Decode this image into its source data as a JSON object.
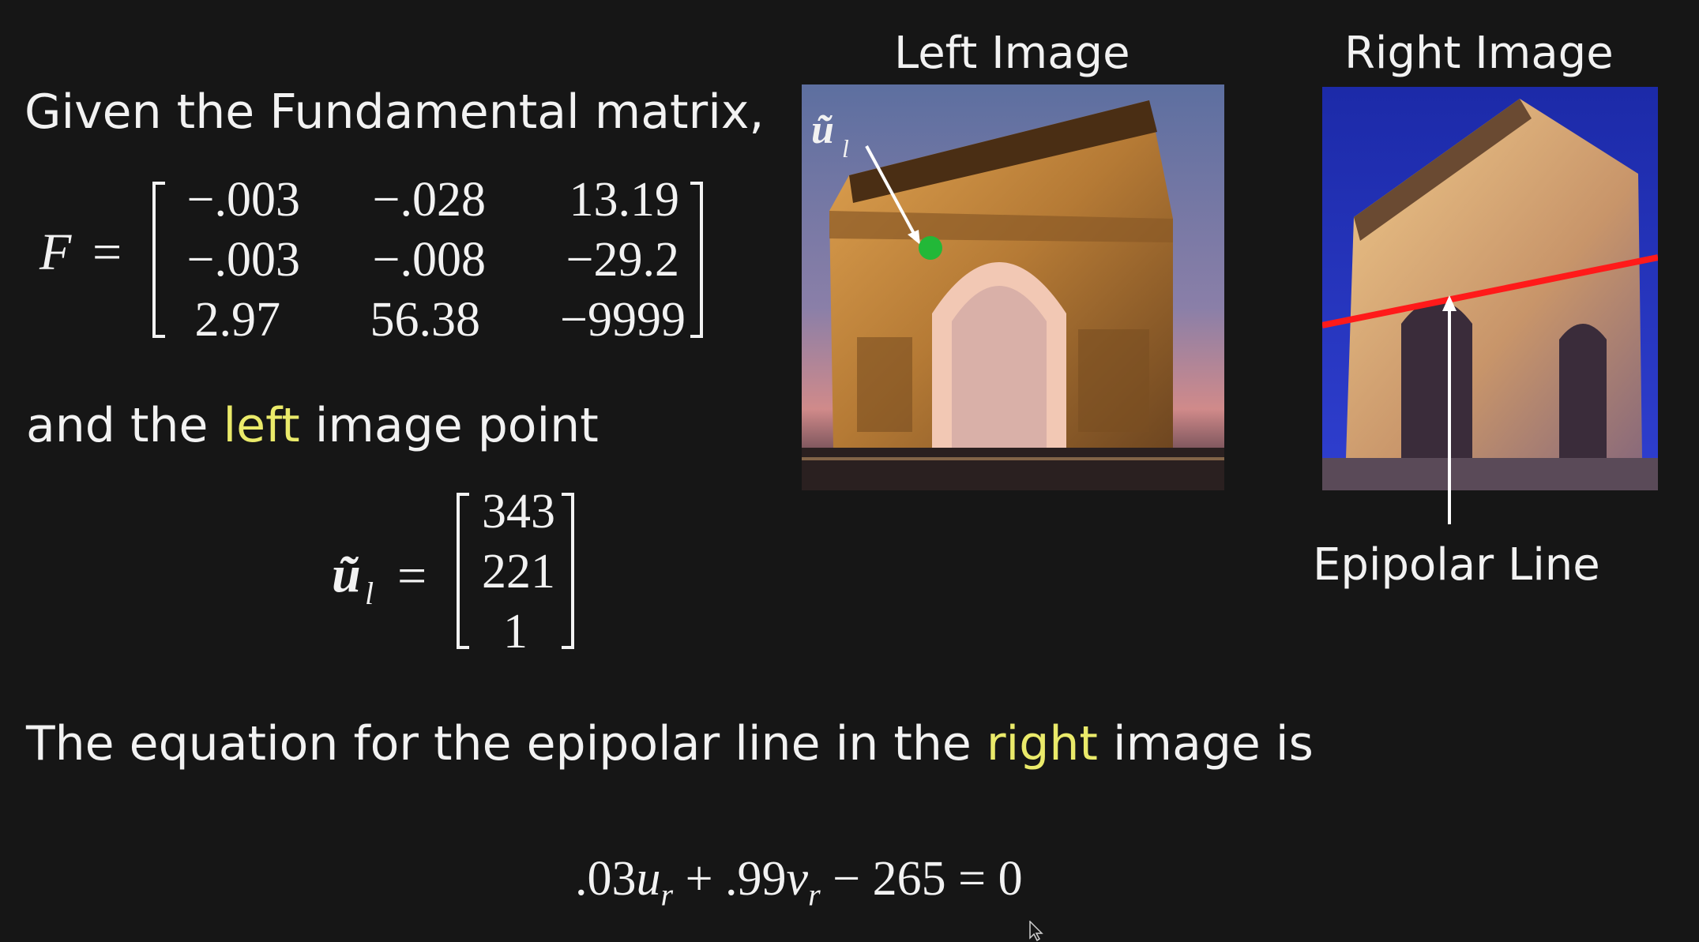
{
  "slide": {
    "intro_text": "Given the Fundamental matrix,",
    "point_text_pre": "and the ",
    "point_text_highlight": "left",
    "point_text_post": " image point",
    "result_text_pre": "The equation for the epipolar line in the ",
    "result_text_highlight": "right",
    "result_text_post": " image is",
    "highlight_color": "#eaea6a"
  },
  "fundamental_matrix": {
    "symbol": "F",
    "equals": "=",
    "rows": [
      [
        "−.003",
        "−.028",
        "13.19"
      ],
      [
        "−.003",
        "−.008",
        "−29.2"
      ],
      [
        "2.97",
        "56.38",
        "−9999"
      ]
    ]
  },
  "left_point": {
    "symbol": "ũ",
    "subscript": "l",
    "equals": "=",
    "values": [
      "343",
      "221",
      "1"
    ]
  },
  "epipolar_equation": {
    "coef_u": ".03",
    "var_u": "u",
    "sub_u": "r",
    "plus": "+",
    "coef_v": ".99",
    "var_v": "v",
    "sub_v": "r",
    "minus": "−",
    "constant": "265",
    "equals": "=",
    "rhs": "0"
  },
  "images": {
    "left_title": "Left Image",
    "right_title": "Right Image",
    "point_label": "ũ",
    "point_label_sub": "l",
    "epipolar_label": "Epipolar Line",
    "point_color": "#22b838",
    "epipolar_line_color": "#ff1a1a",
    "arrow_color": "#ffffff"
  }
}
